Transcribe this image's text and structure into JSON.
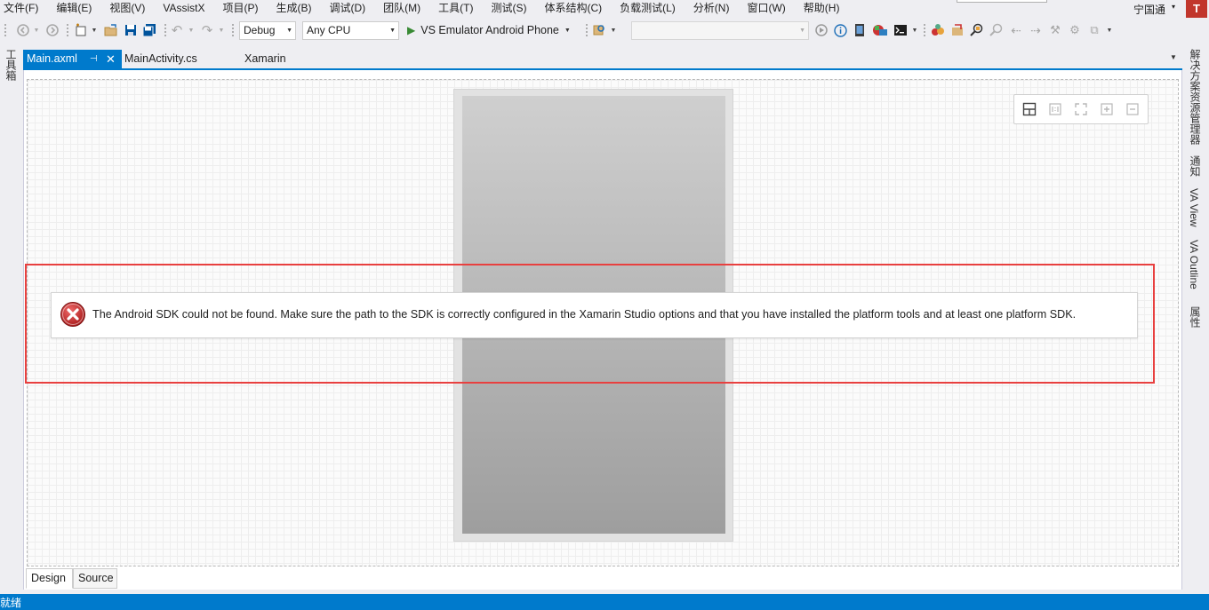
{
  "menu": {
    "items": [
      "文件(F)",
      "编辑(E)",
      "视图(V)",
      "VAssistX",
      "项目(P)",
      "生成(B)",
      "调试(D)",
      "团队(M)",
      "工具(T)",
      "测试(S)",
      "体系结构(C)",
      "负载测试(L)",
      "分析(N)",
      "窗口(W)",
      "帮助(H)"
    ],
    "user": "宁国通",
    "avatar": "T",
    "user_arrow": "▾"
  },
  "toolbar": {
    "config": "Debug",
    "platform": "Any CPU",
    "run_label": "VS Emulator Android Phone",
    "dropdown_arrow": "▼"
  },
  "tabs": {
    "active": "Main.axml",
    "pin": "⊣",
    "close": "✕",
    "second": "MainActivity.cs",
    "third": "Xamarin",
    "overflow": "▼"
  },
  "left_tool": "工具箱",
  "right_tools": [
    "解决方案资源管理器",
    "通知",
    "VA View",
    "VA Outline",
    "属性"
  ],
  "error": {
    "message": "The Android SDK could not be found. Make sure the path to the SDK is correctly configured in the Xamarin Studio options and that you have installed the platform tools and at least one platform SDK."
  },
  "bottom_tabs": {
    "design": "Design",
    "source": "Source"
  },
  "status": {
    "text": "就绪"
  },
  "colors": {
    "accent": "#007acc",
    "error_red": "#c62828",
    "highlight": "#e8403f",
    "run_green": "#388a34"
  }
}
